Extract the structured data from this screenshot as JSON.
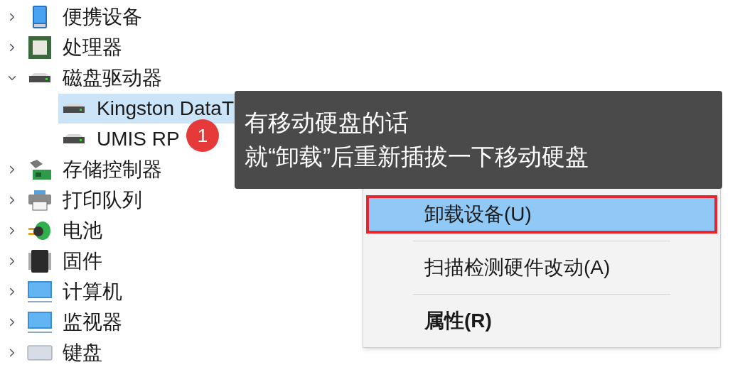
{
  "tree": [
    {
      "label": "便携设备",
      "kind": "portable",
      "expanded": false,
      "selected": false
    },
    {
      "label": "处理器",
      "kind": "cpu",
      "expanded": false,
      "selected": false
    },
    {
      "label": "磁盘驱动器",
      "kind": "disk",
      "expanded": true,
      "selected": false,
      "children": [
        {
          "label": "Kingston DataT",
          "kind": "disk",
          "selected": true
        },
        {
          "label": "UMIS RP",
          "kind": "disk",
          "selected": false
        }
      ]
    },
    {
      "label": "存储控制器",
      "kind": "storage",
      "expanded": false,
      "selected": false
    },
    {
      "label": "打印队列",
      "kind": "printer",
      "expanded": false,
      "selected": false
    },
    {
      "label": "电池",
      "kind": "battery",
      "expanded": false,
      "selected": false
    },
    {
      "label": "固件",
      "kind": "chip",
      "expanded": false,
      "selected": false
    },
    {
      "label": "计算机",
      "kind": "monitor",
      "expanded": false,
      "selected": false
    },
    {
      "label": "监视器",
      "kind": "monitor",
      "expanded": false,
      "selected": false
    },
    {
      "label": "键盘",
      "kind": "keyboard",
      "expanded": false,
      "selected": false
    }
  ],
  "context_menu": {
    "items": [
      {
        "kind": "item",
        "label": "卸载设备(U)",
        "selected": true,
        "bold": false,
        "outlined": true
      },
      {
        "kind": "separator"
      },
      {
        "kind": "item",
        "label": "扫描检测硬件改动(A)",
        "selected": false,
        "bold": false,
        "outlined": false
      },
      {
        "kind": "separator"
      },
      {
        "kind": "item",
        "label": "属性(R)",
        "selected": false,
        "bold": true,
        "outlined": false
      }
    ]
  },
  "annotation": {
    "badge": "1",
    "lines": [
      "有移动硬盘的话",
      "就“卸载”后重新插拔一下移动硬盘"
    ]
  }
}
